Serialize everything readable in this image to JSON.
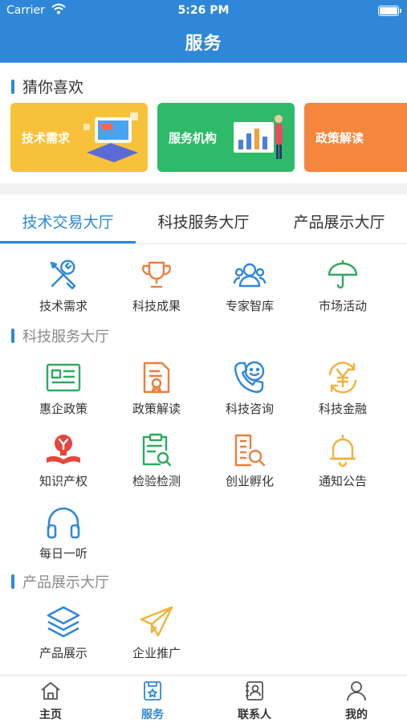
{
  "status_bar": {
    "carrier": "Carrier",
    "time": "5:26 PM"
  },
  "header": {
    "title": "服务"
  },
  "guess": {
    "title": "猜你喜欢",
    "cards": [
      {
        "label": "技术需求",
        "color": "#f7c23a"
      },
      {
        "label": "服务机构",
        "color": "#2dbb6a"
      },
      {
        "label": "政策解读",
        "color": "#f5863e"
      }
    ]
  },
  "tabs": [
    {
      "label": "技术交易大厅",
      "active": true
    },
    {
      "label": "科技服务大厅",
      "active": false
    },
    {
      "label": "产品展示大厅",
      "active": false
    }
  ],
  "trade_hall": {
    "items": [
      {
        "label": "技术需求",
        "icon": "tools-icon"
      },
      {
        "label": "科技成果",
        "icon": "trophy-icon"
      },
      {
        "label": "专家智库",
        "icon": "users-icon"
      },
      {
        "label": "市场活动",
        "icon": "umbrella-icon"
      }
    ]
  },
  "service_hall": {
    "title": "科技服务大厅",
    "items": [
      {
        "label": "惠企政策",
        "icon": "newspaper-icon"
      },
      {
        "label": "政策解读",
        "icon": "certificate-icon"
      },
      {
        "label": "科技咨询",
        "icon": "phone-smile-icon"
      },
      {
        "label": "科技金融",
        "icon": "yuan-icon"
      },
      {
        "label": "知识产权",
        "icon": "ip-bulb-icon"
      },
      {
        "label": "检验检测",
        "icon": "clipboard-search-icon"
      },
      {
        "label": "创业孵化",
        "icon": "building-search-icon"
      },
      {
        "label": "通知公告",
        "icon": "bell-icon"
      },
      {
        "label": "每日一听",
        "icon": "headphones-icon"
      }
    ]
  },
  "product_hall": {
    "title": "产品展示大厅",
    "items": [
      {
        "label": "产品展示",
        "icon": "layers-icon"
      },
      {
        "label": "企业推广",
        "icon": "paper-plane-icon"
      }
    ]
  },
  "bottom_nav": [
    {
      "label": "主页",
      "icon": "home-icon",
      "active": false
    },
    {
      "label": "服务",
      "icon": "service-icon",
      "active": true
    },
    {
      "label": "联系人",
      "icon": "contacts-icon",
      "active": false
    },
    {
      "label": "我的",
      "icon": "person-icon",
      "active": false
    }
  ],
  "colors": {
    "primary": "#2f87d9",
    "green": "#2dab5f",
    "orange": "#ef7d3b",
    "yellow": "#f0b23a",
    "red": "#e6453c"
  }
}
